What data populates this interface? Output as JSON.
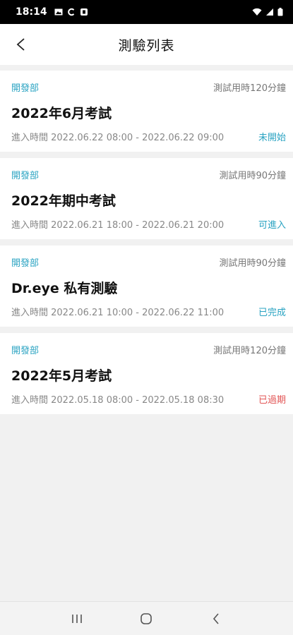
{
  "status_bar": {
    "time": "18:14",
    "left_icons": [
      "image-icon",
      "c-icon",
      "square-icon"
    ],
    "right_icons": [
      "wifi-icon",
      "signal-icon",
      "battery-icon"
    ]
  },
  "header": {
    "back_icon": "chevron-left-icon",
    "title": "測驗列表"
  },
  "colors": {
    "accent": "#2aa3c2",
    "expired": "#e25656",
    "muted": "#888888"
  },
  "exams": [
    {
      "department": "開發部",
      "duration": "測試用時120分鐘",
      "title": "2022年6月考試",
      "time_range": "進入時間 2022.06.22 08:00 - 2022.06.22 09:00",
      "status": "未開始",
      "status_color": "#2aa3c2"
    },
    {
      "department": "開發部",
      "duration": "測試用時90分鐘",
      "title": "2022年期中考試",
      "time_range": "進入時間 2022.06.21 18:00 - 2022.06.21 20:00",
      "status": "可進入",
      "status_color": "#2aa3c2"
    },
    {
      "department": "開發部",
      "duration": "測試用時90分鐘",
      "title": "Dr.eye 私有測驗",
      "time_range": "進入時間 2022.06.21 10:00 - 2022.06.22 11:00",
      "status": "已完成",
      "status_color": "#2aa3c2"
    },
    {
      "department": "開發部",
      "duration": "測試用時120分鐘",
      "title": "2022年5月考試",
      "time_range": "進入時間 2022.05.18 08:00 - 2022.05.18 08:30",
      "status": "已過期",
      "status_color": "#e25656"
    }
  ],
  "nav_bar": {
    "icons": [
      "recent-apps-icon",
      "home-icon",
      "back-icon"
    ]
  }
}
